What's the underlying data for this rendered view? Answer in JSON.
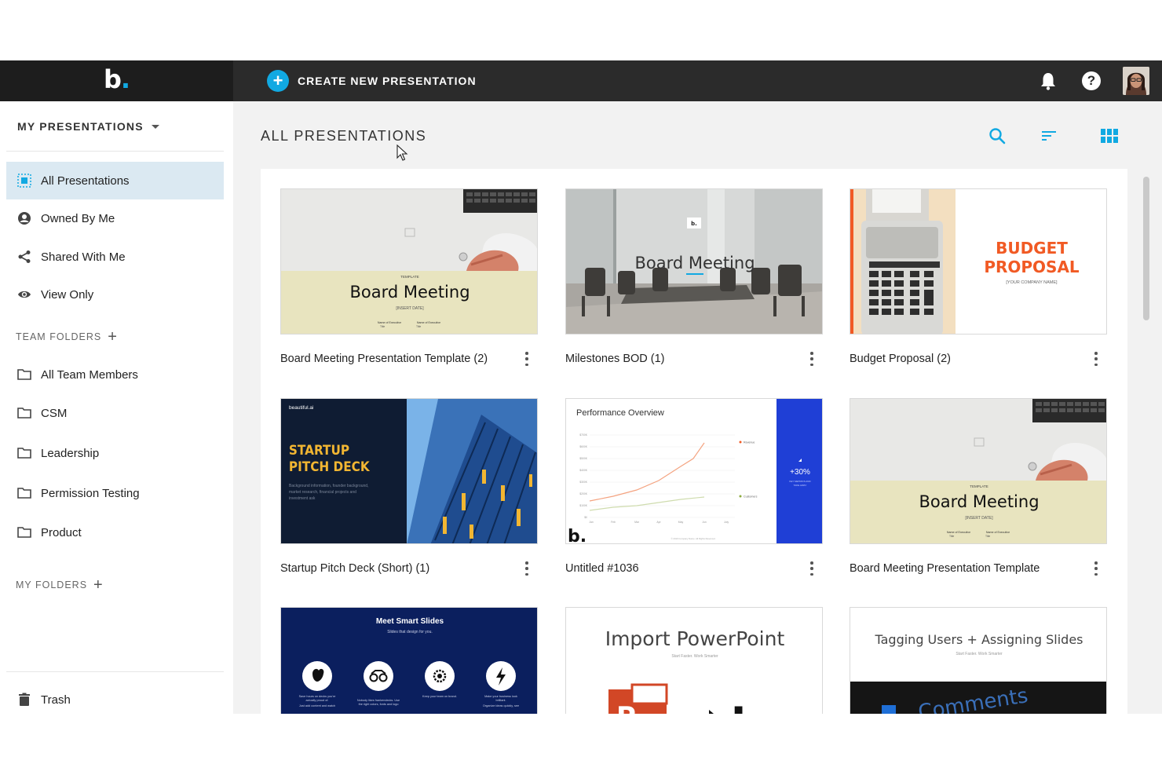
{
  "app": {
    "logo_text": "b",
    "logo_dot": "."
  },
  "topbar": {
    "create_label": "CREATE NEW PRESENTATION",
    "help_glyph": "?"
  },
  "sidebar": {
    "header": "MY PRESENTATIONS",
    "items": [
      {
        "label": "All Presentations",
        "icon": "all-presentations-icon"
      },
      {
        "label": "Owned By Me",
        "icon": "user-icon"
      },
      {
        "label": "Shared With Me",
        "icon": "share-icon"
      },
      {
        "label": "View Only",
        "icon": "eye-icon"
      }
    ],
    "team_folders_label": "TEAM FOLDERS",
    "team_folders": [
      "All Team Members",
      "CSM",
      "Leadership",
      "Permission Testing",
      "Product"
    ],
    "my_folders_label": "MY FOLDERS",
    "trash_label": "Trash",
    "plus_glyph": "+"
  },
  "main": {
    "title": "ALL PRESENTATIONS",
    "cards": [
      {
        "title": "Board Meeting Presentation Template (2)",
        "thumb": {
          "template_tag": "TEMPLATE",
          "heading": "Board Meeting",
          "date": "[INSERT DATE]",
          "name1": "Name of Executive",
          "title1": "Title",
          "name2": "Name of Executive",
          "title2": "Title"
        }
      },
      {
        "title": "Milestones BOD (1)",
        "thumb": {
          "logo": "b.",
          "heading": "Board Meeting"
        }
      },
      {
        "title": "Budget Proposal (2)",
        "thumb": {
          "heading1": "BUDGET",
          "heading2": "PROPOSAL",
          "company": "[YOUR COMPANY NAME]"
        }
      },
      {
        "title": "Startup Pitch Deck (Short) (1)",
        "thumb": {
          "brand": "beautiful.ai",
          "heading1": "STARTUP",
          "heading2": "PITCH DECK",
          "body": "Background information, founder background, market research, financial projects and investment ask"
        }
      },
      {
        "title": "Untitled #1036",
        "thumb": {
          "heading": "Performance Overview",
          "legend_revenue": "Revenue",
          "legend_customers": "Customers",
          "stat": "+30%",
          "stat_sub": "KEY METRICS AND TAKE AWAY",
          "logo": "b.",
          "y_ticks": [
            "$700K",
            "$600K",
            "$500K",
            "$400K",
            "$300K",
            "$200K",
            "$100K",
            "$0"
          ],
          "x_ticks": [
            "Jan",
            "Feb",
            "Mar",
            "Apr",
            "May",
            "Jun",
            "July"
          ],
          "footer": "© 2019 Company Name. All Rights Reserved."
        }
      },
      {
        "title": "Board Meeting Presentation Template",
        "thumb": {
          "template_tag": "TEMPLATE",
          "heading": "Board Meeting",
          "date": "[INSERT DATE]",
          "name1": "Name of Executive",
          "title1": "Title",
          "name2": "Name of Executive",
          "title2": "Title"
        }
      },
      {
        "title": "",
        "thumb": {
          "heading": "Meet Smart Slides",
          "sub": "Slides that design for you.",
          "captions": [
            "Save hours on decks you're actually proud of.",
            "Nobody likes frankendecks. Use the right colors, fonts and logo every time.",
            "Keep your team on brand.",
            "Make your business look brilliant."
          ],
          "captions2": [
            "Just add content and watch your slides adapt intelligently.",
            "",
            "",
            "Organize ideas quickly, see slides instantly, and share them with teams."
          ]
        }
      },
      {
        "title": "",
        "thumb": {
          "heading": "Import PowerPoint",
          "sub": "Start Faster. Work Smarter"
        }
      },
      {
        "title": "",
        "thumb": {
          "heading": "Tagging Users + Assigning Slides",
          "sub": "Start Faster. Work Smarter",
          "screen_text": "Comments"
        }
      }
    ]
  },
  "colors": {
    "accent": "#11a9e2",
    "active_nav": "#dbe9f2",
    "topbar": "#2b2b2b",
    "budget_orange": "#f15a24",
    "pitch_navy": "#0f1c33",
    "pitch_gold": "#f2b632",
    "perf_blue": "#1f3fd6",
    "smart_navy": "#0b1f5e"
  }
}
